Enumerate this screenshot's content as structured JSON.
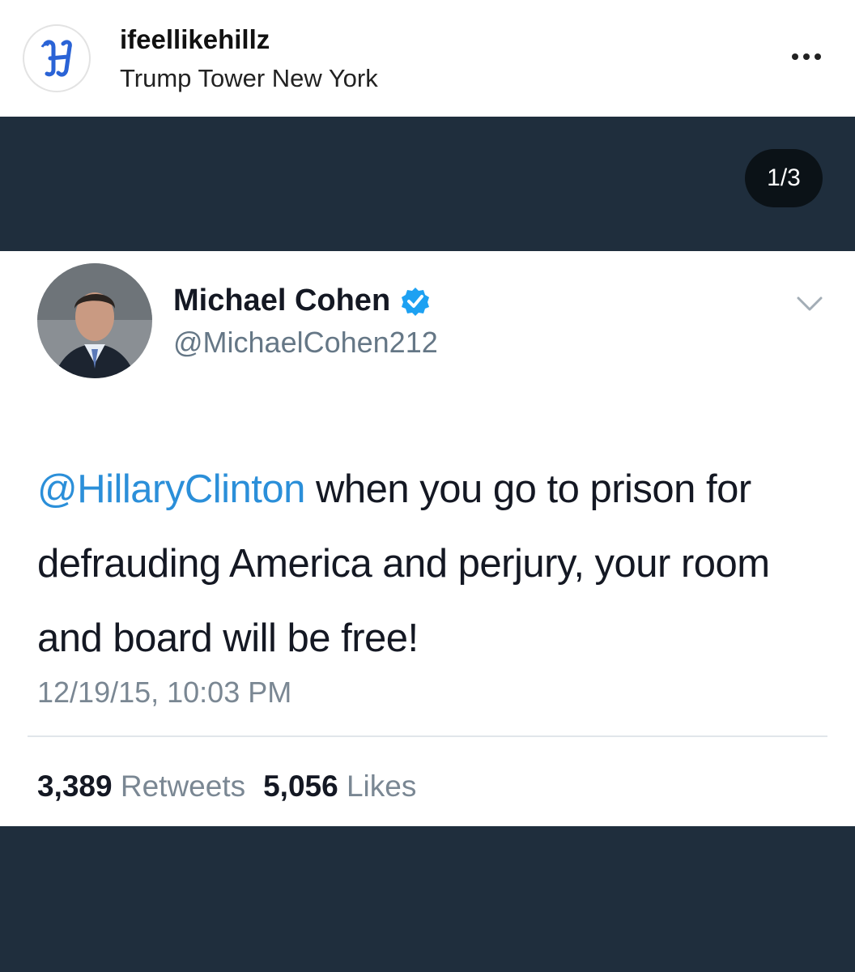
{
  "post": {
    "username": "ifeellikehillz",
    "location": "Trump Tower New York",
    "avatar_icon": "gothic-h-logo-icon",
    "more_icon": "more-options-icon",
    "carousel_counter": "1/3"
  },
  "tweet": {
    "display_name": "Michael Cohen",
    "handle": "@MichaelCohen212",
    "verified_icon": "verified-badge-icon",
    "menu_icon": "chevron-down-icon",
    "mention": "@HillaryClinton",
    "text": " when you go to prison for defrauding America and perjury, your room and board will be free!",
    "timestamp": "12/19/15, 10:03 PM",
    "retweets_count": "3,389",
    "retweets_label": "Retweets",
    "likes_count": "5,056",
    "likes_label": "Likes"
  },
  "colors": {
    "media_background": "#1f2e3d",
    "mention": "#2b8fd9",
    "verified": "#1da1f2",
    "secondary_text": "#7a8793"
  }
}
